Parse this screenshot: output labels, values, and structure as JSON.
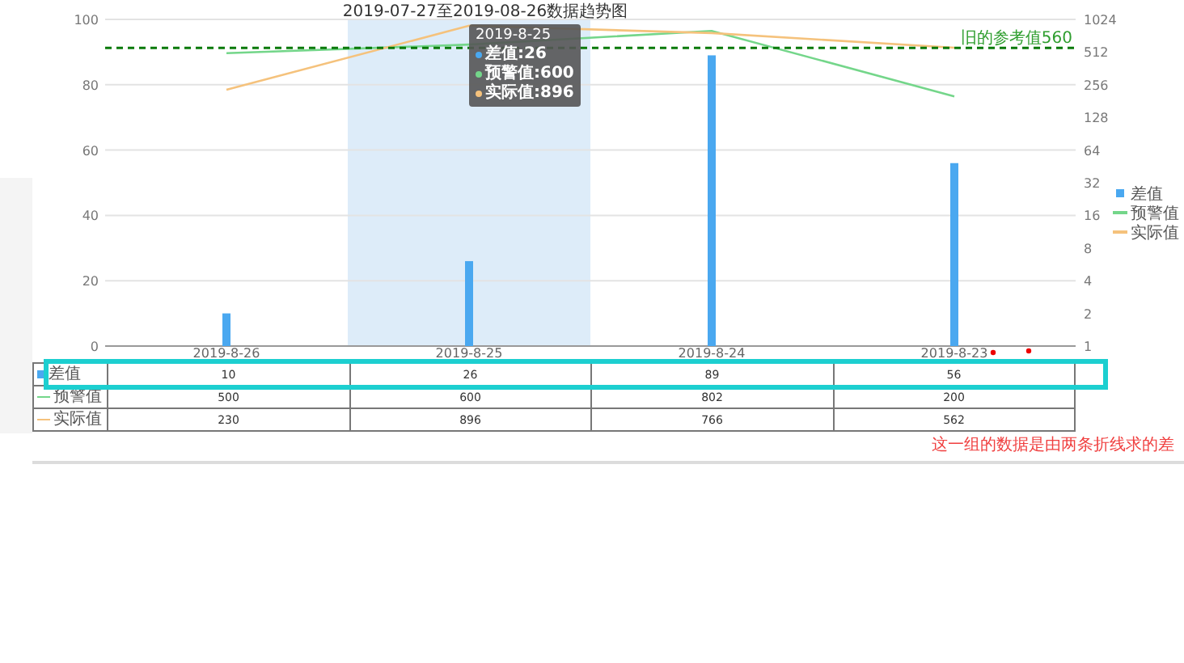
{
  "chart": {
    "title": "2019-07-27至2019-08-26数据趋势图",
    "chart_data": {
      "type": "bar",
      "categories": [
        "2019-8-26",
        "2019-8-25",
        "2019-8-24",
        "2019-8-23"
      ],
      "series": [
        {
          "name": "差值",
          "color": "#4aa8f0",
          "values": [
            10,
            26,
            89,
            56
          ]
        }
      ],
      "ylim": [
        0,
        100
      ],
      "yticks": [
        0,
        20,
        40,
        60,
        80,
        100
      ],
      "grid": true
    },
    "right_axis": {
      "ticks": [
        "1024",
        "512",
        "256",
        "128",
        "64",
        "32",
        "16",
        "8",
        "4",
        "2",
        "1"
      ]
    },
    "line_series": [
      {
        "name": "预警值",
        "color": "#74d68a"
      },
      {
        "name": "实际值",
        "color": "#f5c27c"
      }
    ],
    "reference_line": {
      "label": "旧的参考值560"
    },
    "columns": [
      {
        "selected": false
      },
      {
        "selected": true
      },
      {
        "selected": false
      },
      {
        "selected": false
      }
    ],
    "tooltip": {
      "title": "2019-8-25",
      "items": [
        {
          "label": "差值:26"
        },
        {
          "label": "预警值:600"
        },
        {
          "label": "实际值:896"
        }
      ]
    },
    "data_table": {
      "rows": [
        {
          "label": "差值",
          "highlighted": true,
          "cells": [
            "10",
            "26",
            "89",
            "56"
          ]
        },
        {
          "label": "预警值",
          "highlighted": false,
          "cells": [
            "500",
            "600",
            "802",
            "200"
          ]
        },
        {
          "label": "实际值",
          "highlighted": false,
          "cells": [
            "230",
            "896",
            "766",
            "562"
          ]
        }
      ]
    },
    "note": "这一组的数据是由两条折线求的差"
  }
}
